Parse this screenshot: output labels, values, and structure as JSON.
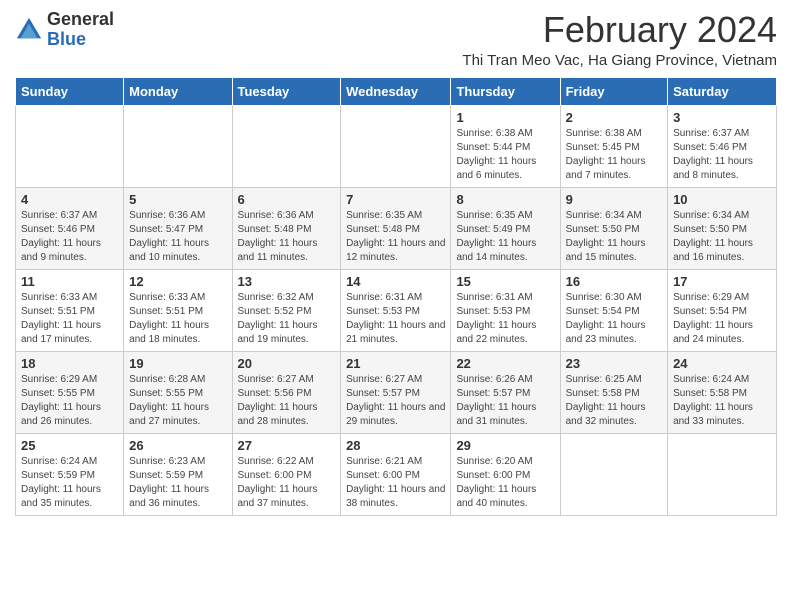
{
  "logo": {
    "general": "General",
    "blue": "Blue"
  },
  "title": "February 2024",
  "subtitle": "Thi Tran Meo Vac, Ha Giang Province, Vietnam",
  "headers": [
    "Sunday",
    "Monday",
    "Tuesday",
    "Wednesday",
    "Thursday",
    "Friday",
    "Saturday"
  ],
  "weeks": [
    [
      {
        "day": "",
        "info": ""
      },
      {
        "day": "",
        "info": ""
      },
      {
        "day": "",
        "info": ""
      },
      {
        "day": "",
        "info": ""
      },
      {
        "day": "1",
        "info": "Sunrise: 6:38 AM\nSunset: 5:44 PM\nDaylight: 11 hours and 6 minutes."
      },
      {
        "day": "2",
        "info": "Sunrise: 6:38 AM\nSunset: 5:45 PM\nDaylight: 11 hours and 7 minutes."
      },
      {
        "day": "3",
        "info": "Sunrise: 6:37 AM\nSunset: 5:46 PM\nDaylight: 11 hours and 8 minutes."
      }
    ],
    [
      {
        "day": "4",
        "info": "Sunrise: 6:37 AM\nSunset: 5:46 PM\nDaylight: 11 hours and 9 minutes."
      },
      {
        "day": "5",
        "info": "Sunrise: 6:36 AM\nSunset: 5:47 PM\nDaylight: 11 hours and 10 minutes."
      },
      {
        "day": "6",
        "info": "Sunrise: 6:36 AM\nSunset: 5:48 PM\nDaylight: 11 hours and 11 minutes."
      },
      {
        "day": "7",
        "info": "Sunrise: 6:35 AM\nSunset: 5:48 PM\nDaylight: 11 hours and 12 minutes."
      },
      {
        "day": "8",
        "info": "Sunrise: 6:35 AM\nSunset: 5:49 PM\nDaylight: 11 hours and 14 minutes."
      },
      {
        "day": "9",
        "info": "Sunrise: 6:34 AM\nSunset: 5:50 PM\nDaylight: 11 hours and 15 minutes."
      },
      {
        "day": "10",
        "info": "Sunrise: 6:34 AM\nSunset: 5:50 PM\nDaylight: 11 hours and 16 minutes."
      }
    ],
    [
      {
        "day": "11",
        "info": "Sunrise: 6:33 AM\nSunset: 5:51 PM\nDaylight: 11 hours and 17 minutes."
      },
      {
        "day": "12",
        "info": "Sunrise: 6:33 AM\nSunset: 5:51 PM\nDaylight: 11 hours and 18 minutes."
      },
      {
        "day": "13",
        "info": "Sunrise: 6:32 AM\nSunset: 5:52 PM\nDaylight: 11 hours and 19 minutes."
      },
      {
        "day": "14",
        "info": "Sunrise: 6:31 AM\nSunset: 5:53 PM\nDaylight: 11 hours and 21 minutes."
      },
      {
        "day": "15",
        "info": "Sunrise: 6:31 AM\nSunset: 5:53 PM\nDaylight: 11 hours and 22 minutes."
      },
      {
        "day": "16",
        "info": "Sunrise: 6:30 AM\nSunset: 5:54 PM\nDaylight: 11 hours and 23 minutes."
      },
      {
        "day": "17",
        "info": "Sunrise: 6:29 AM\nSunset: 5:54 PM\nDaylight: 11 hours and 24 minutes."
      }
    ],
    [
      {
        "day": "18",
        "info": "Sunrise: 6:29 AM\nSunset: 5:55 PM\nDaylight: 11 hours and 26 minutes."
      },
      {
        "day": "19",
        "info": "Sunrise: 6:28 AM\nSunset: 5:55 PM\nDaylight: 11 hours and 27 minutes."
      },
      {
        "day": "20",
        "info": "Sunrise: 6:27 AM\nSunset: 5:56 PM\nDaylight: 11 hours and 28 minutes."
      },
      {
        "day": "21",
        "info": "Sunrise: 6:27 AM\nSunset: 5:57 PM\nDaylight: 11 hours and 29 minutes."
      },
      {
        "day": "22",
        "info": "Sunrise: 6:26 AM\nSunset: 5:57 PM\nDaylight: 11 hours and 31 minutes."
      },
      {
        "day": "23",
        "info": "Sunrise: 6:25 AM\nSunset: 5:58 PM\nDaylight: 11 hours and 32 minutes."
      },
      {
        "day": "24",
        "info": "Sunrise: 6:24 AM\nSunset: 5:58 PM\nDaylight: 11 hours and 33 minutes."
      }
    ],
    [
      {
        "day": "25",
        "info": "Sunrise: 6:24 AM\nSunset: 5:59 PM\nDaylight: 11 hours and 35 minutes."
      },
      {
        "day": "26",
        "info": "Sunrise: 6:23 AM\nSunset: 5:59 PM\nDaylight: 11 hours and 36 minutes."
      },
      {
        "day": "27",
        "info": "Sunrise: 6:22 AM\nSunset: 6:00 PM\nDaylight: 11 hours and 37 minutes."
      },
      {
        "day": "28",
        "info": "Sunrise: 6:21 AM\nSunset: 6:00 PM\nDaylight: 11 hours and 38 minutes."
      },
      {
        "day": "29",
        "info": "Sunrise: 6:20 AM\nSunset: 6:00 PM\nDaylight: 11 hours and 40 minutes."
      },
      {
        "day": "",
        "info": ""
      },
      {
        "day": "",
        "info": ""
      }
    ]
  ]
}
